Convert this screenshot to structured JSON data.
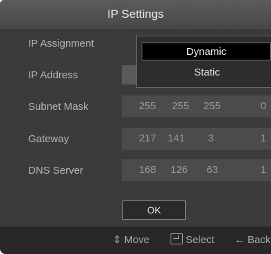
{
  "dialog": {
    "title": "IP Settings"
  },
  "rows": [
    {
      "label": "IP Assignment"
    },
    {
      "label": "IP Address"
    },
    {
      "label": "Subnet Mask",
      "octets": [
        "255",
        "255",
        "255",
        "0"
      ]
    },
    {
      "label": "Gateway",
      "octets": [
        "217",
        "141",
        "3",
        "1"
      ]
    },
    {
      "label": "DNS Server",
      "octets": [
        "168",
        "126",
        "63",
        "1"
      ]
    }
  ],
  "dropdown": {
    "options": [
      "Dynamic",
      "Static"
    ],
    "selected": "Dynamic"
  },
  "ok_label": "OK",
  "footer": {
    "move_label": "Move",
    "select_label": "Select",
    "back_label": "Back"
  },
  "colors": {
    "background": "#3b3b3b",
    "field": "#4b4b4b",
    "selected_option": "#000000"
  }
}
